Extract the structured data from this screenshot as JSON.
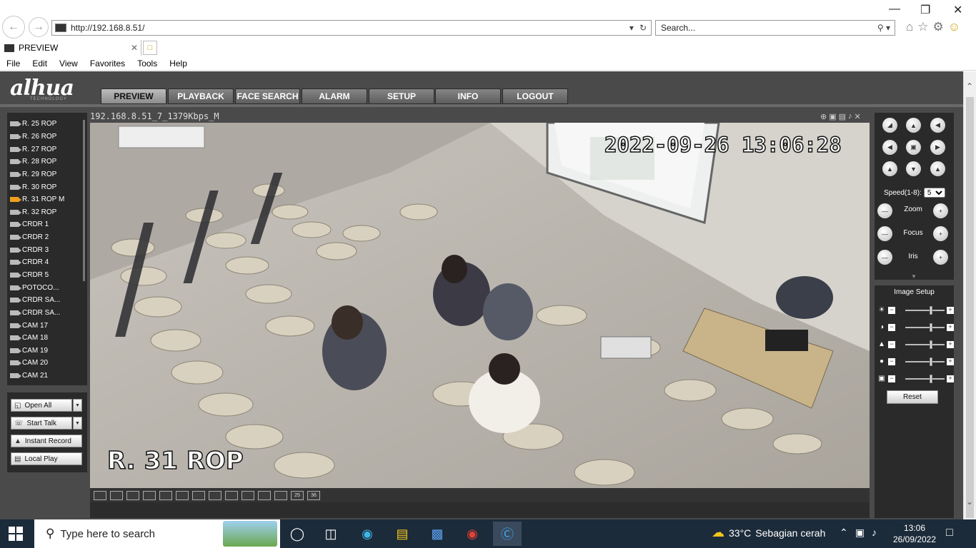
{
  "browser": {
    "url": "http://192.168.8.51/",
    "search_placeholder": "Search...",
    "tab_title": "PREVIEW",
    "menu": [
      "File",
      "Edit",
      "View",
      "Favorites",
      "Tools",
      "Help"
    ]
  },
  "app": {
    "logo": "alhua",
    "logo_sub": "TECHNOLOGY",
    "nav_tabs": [
      "PREVIEW",
      "PLAYBACK",
      "FACE SEARCH",
      "ALARM",
      "SETUP",
      "INFO",
      "LOGOUT"
    ],
    "active_tab": "PREVIEW",
    "channels": [
      "R. 25 ROP",
      "R. 26 ROP",
      "R. 27 ROP",
      "R. 28 ROP",
      "R. 29 ROP",
      "R. 30 ROP",
      "R. 31 ROP   M",
      "R. 32 ROP",
      "CRDR 1",
      "CRDR 2",
      "CRDR 3",
      "CRDR 4",
      "CRDR 5",
      "POTOCO...",
      "CRDR SA...",
      "CRDR SA...",
      "CAM 17",
      "CAM 18",
      "CAM 19",
      "CAM 20",
      "CAM 21"
    ],
    "active_channel_index": 6,
    "buttons": {
      "open_all": "Open All",
      "start_talk": "Start Talk",
      "instant_record": "Instant Record",
      "local_play": "Local Play"
    },
    "video": {
      "stream_title": "192.168.8.51_7_1379Kbps_M",
      "osd_time": "2022-09-26 13:06:28",
      "osd_name": "R. 31 ROP"
    },
    "layout_buttons": [
      "",
      "",
      "",
      "",
      "",
      "",
      "",
      "",
      "",
      "",
      "",
      "",
      "25",
      "36"
    ],
    "ptz": {
      "speed_label": "Speed(1-8):",
      "speed_value": "5",
      "zoom": "Zoom",
      "focus": "Focus",
      "iris": "Iris"
    },
    "image_setup": {
      "title": "Image Setup",
      "reset": "Reset",
      "sliders": [
        {
          "icon": "brightness-icon",
          "value": 0.5
        },
        {
          "icon": "contrast-icon",
          "value": 0.5
        },
        {
          "icon": "saturation-icon",
          "value": 0.5
        },
        {
          "icon": "hue-icon",
          "value": 0.5
        },
        {
          "icon": "sharpness-icon",
          "value": 0.5
        }
      ]
    }
  },
  "taskbar": {
    "search_placeholder": "Type here to search",
    "weather_temp": "33°C",
    "weather_text": "Sebagian cerah",
    "time": "13:06",
    "date": "26/09/2022"
  }
}
